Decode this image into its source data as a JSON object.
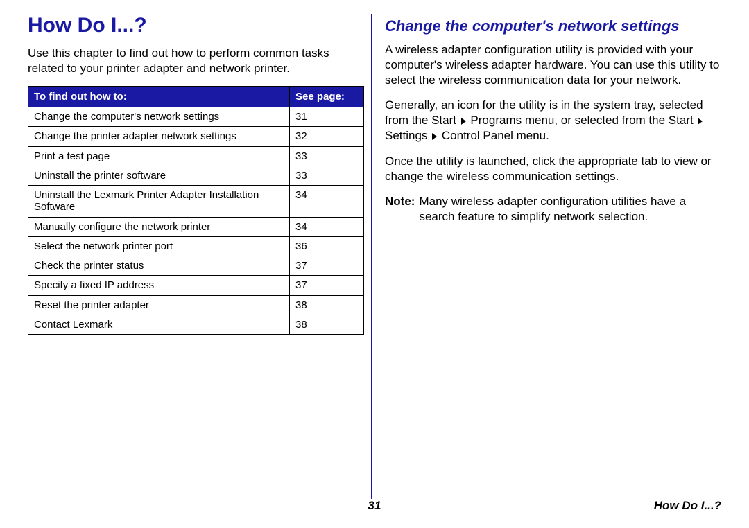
{
  "left": {
    "title": "How Do I...?",
    "intro": "Use this chapter to find out how to perform common tasks related to your printer adapter and network printer.",
    "table": {
      "header_topic": "To find out how to:",
      "header_page": "See page:",
      "rows": [
        {
          "topic": "Change the computer's network settings",
          "page": "31"
        },
        {
          "topic": "Change the printer adapter network settings",
          "page": "32"
        },
        {
          "topic": "Print a test page",
          "page": "33"
        },
        {
          "topic": "Uninstall the printer software",
          "page": "33"
        },
        {
          "topic": "Uninstall the Lexmark Printer Adapter Installation Software",
          "page": "34"
        },
        {
          "topic": "Manually configure the network printer",
          "page": "34"
        },
        {
          "topic": "Select the network printer port",
          "page": "36"
        },
        {
          "topic": "Check the printer status",
          "page": "37"
        },
        {
          "topic": "Specify a fixed IP address",
          "page": "37"
        },
        {
          "topic": "Reset the printer adapter",
          "page": "38"
        },
        {
          "topic": "Contact Lexmark",
          "page": "38"
        }
      ]
    }
  },
  "right": {
    "title": "Change the computer's network settings",
    "p1": "A wireless adapter configuration utility is provided with your computer's wireless adapter hardware. You can use this utility to select the wireless communication data for your network.",
    "p2a": "Generally, an icon for the utility is in the system tray, selected from the Start ",
    "p2b": " Programs menu, or selected from the Start ",
    "p2c": " Settings ",
    "p2d": " Control Panel menu.",
    "p3": "Once the utility is launched, click the appropriate tab to view or change the wireless communication settings.",
    "note_label": "Note:",
    "note_text": "Many wireless adapter configuration utilities have a search feature to simplify network selection."
  },
  "footer": {
    "page_number": "31",
    "section": "How Do I...?"
  }
}
